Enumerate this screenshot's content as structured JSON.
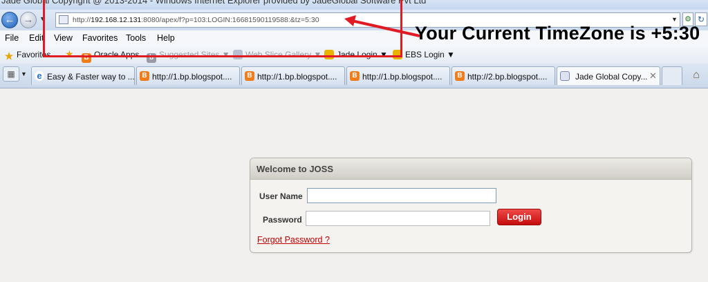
{
  "browser": {
    "title_bar": "Jade Global Copyright @ 2013-2014 - Windows Internet Explorer provided by JadeGlobal Software Pvt Ltd",
    "address": {
      "prefix": "http://",
      "host": "192.168.12.131",
      "rest": ":8080/apex/f?p=103:LOGIN:16681590119588:&tz=5:30"
    },
    "menu": [
      "File",
      "Edit",
      "View",
      "Favorites",
      "Tools",
      "Help"
    ],
    "favorites_bar": {
      "favorites_label": "Favorites",
      "items": [
        {
          "label": "Oracle Apps",
          "faded": false
        },
        {
          "label": "Suggested Sites",
          "faded": true
        },
        {
          "label": "Web Slice Gallery",
          "faded": true
        },
        {
          "label": "Jade Login",
          "faded": false
        },
        {
          "label": "EBS Login",
          "faded": false
        }
      ]
    },
    "tabs": [
      {
        "label": "Easy & Faster way to ...",
        "icon": "ie-icon"
      },
      {
        "label": "http://1.bp.blogspot....",
        "icon": "blogger-icon"
      },
      {
        "label": "http://1.bp.blogspot....",
        "icon": "blogger-icon"
      },
      {
        "label": "http://1.bp.blogspot....",
        "icon": "blogger-icon"
      },
      {
        "label": "http://2.bp.blogspot....",
        "icon": "blogger-icon"
      },
      {
        "label": "Jade Global Copy...",
        "icon": "page-icon",
        "active": true
      }
    ]
  },
  "annotation": {
    "note": "Your Current TimeZone is +5:30",
    "color": "#e01b24"
  },
  "login": {
    "panel_title": "Welcome to JOSS",
    "username_label": "User Name",
    "password_label": "Password",
    "username_value": "",
    "password_value": "",
    "login_button": "Login",
    "forgot_link": "Forgot Password ?"
  },
  "colors": {
    "login_button": "#d81414",
    "forgot_link": "#c00000"
  }
}
